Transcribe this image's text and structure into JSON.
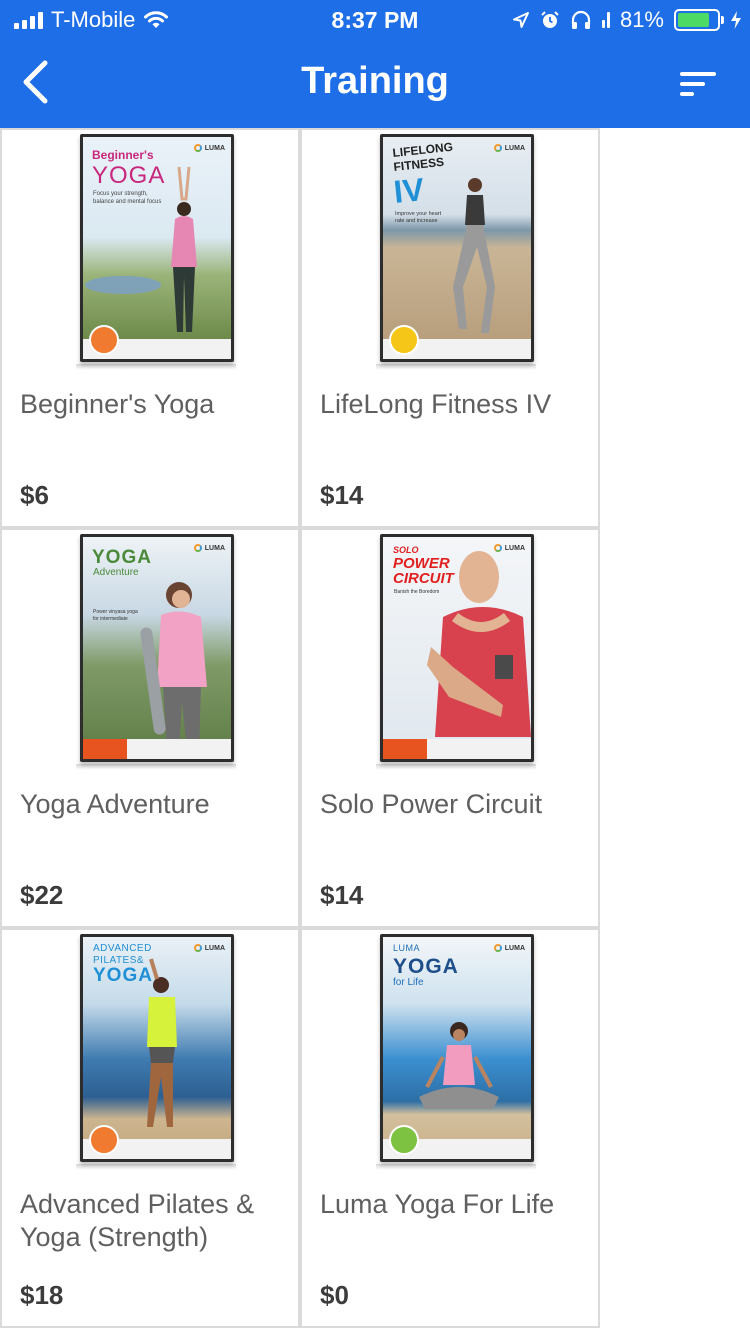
{
  "status_bar": {
    "carrier": "T-Mobile",
    "time": "8:37 PM",
    "battery_percent": "81%",
    "battery_level": 0.81
  },
  "header": {
    "title": "Training",
    "back_icon": "chevron-left-icon",
    "sort_icon": "sort-lines-icon",
    "background_color": "#1e6ee8"
  },
  "products": [
    {
      "name": "Beginner's Yoga",
      "price": "$6"
    },
    {
      "name": "LifeLong Fitness IV",
      "price": "$14"
    },
    {
      "name": "Yoga Adventure",
      "price": "$22"
    },
    {
      "name": "Solo Power Circuit",
      "price": "$14"
    },
    {
      "name": "Advanced Pilates & Yoga (Strength)",
      "price": "$18"
    },
    {
      "name": "Luma Yoga For Life",
      "price": "$0"
    }
  ]
}
